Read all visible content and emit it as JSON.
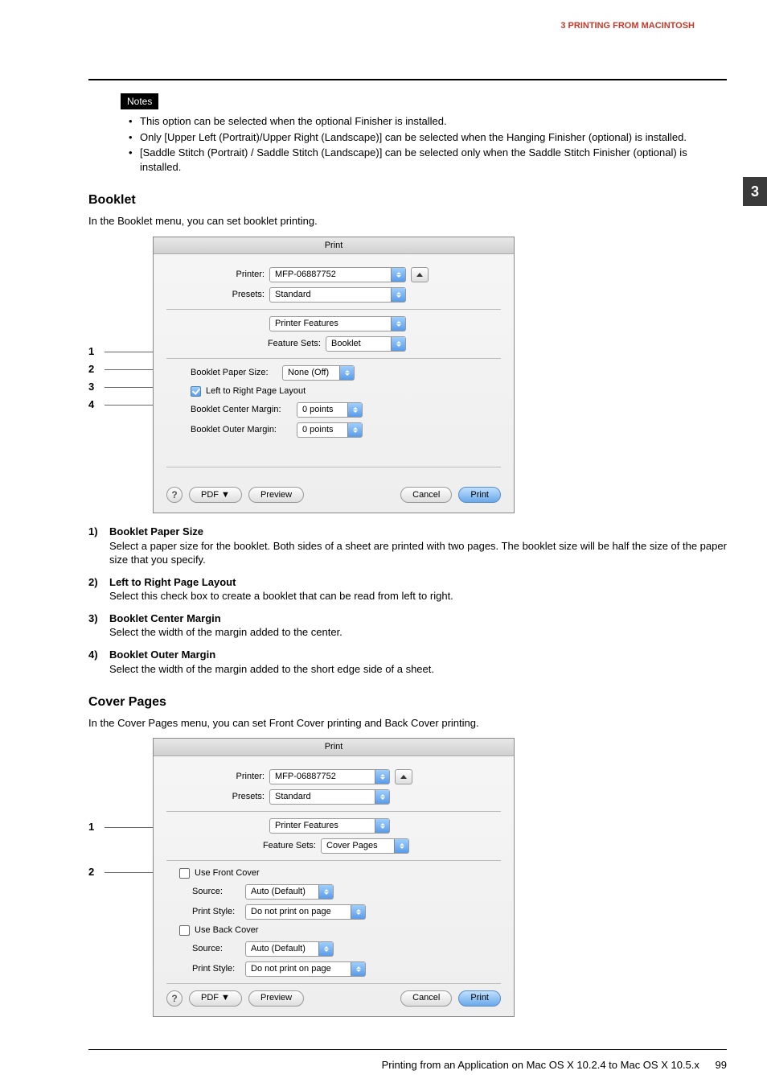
{
  "header": {
    "breadcrumb": "3 PRINTING FROM MACINTOSH",
    "tab": "3"
  },
  "notes": {
    "label": "Notes",
    "items": [
      "This option can be selected when the optional Finisher is installed.",
      "Only [Upper Left (Portrait)/Upper Right (Landscape)] can be selected when the Hanging Finisher (optional) is installed.",
      "[Saddle Stitch (Portrait) / Saddle Stitch (Landscape)] can be selected only when the Saddle Stitch Finisher (optional) is installed."
    ]
  },
  "booklet": {
    "heading": "Booklet",
    "intro": "In the Booklet menu, you can set booklet printing.",
    "callouts": [
      "1",
      "2",
      "3",
      "4"
    ],
    "dialog": {
      "title": "Print",
      "printer_label": "Printer:",
      "printer_value": "MFP-06887752",
      "presets_label": "Presets:",
      "presets_value": "Standard",
      "pane_value": "Printer Features",
      "featuresets_label": "Feature Sets:",
      "featuresets_value": "Booklet",
      "paper_label": "Booklet Paper Size:",
      "paper_value": "None (Off)",
      "ltr_label": "Left to Right Page Layout",
      "center_label": "Booklet Center Margin:",
      "center_value": "0 points",
      "outer_label": "Booklet Outer Margin:",
      "outer_value": "0 points",
      "help": "?",
      "pdf": "PDF ▼",
      "preview": "Preview",
      "cancel": "Cancel",
      "print": "Print"
    },
    "defs": [
      {
        "n": "1)",
        "t": "Booklet Paper Size",
        "d": "Select a paper size for the booklet. Both sides of a sheet are printed with two pages. The booklet size will be half the size of the paper size that you specify."
      },
      {
        "n": "2)",
        "t": "Left to Right Page Layout",
        "d": "Select this check box to create a booklet that can be read from left to right."
      },
      {
        "n": "3)",
        "t": "Booklet Center Margin",
        "d": "Select the width of the margin added to the center."
      },
      {
        "n": "4)",
        "t": "Booklet Outer Margin",
        "d": "Select the width of the margin added to the short edge side of a sheet."
      }
    ]
  },
  "cover": {
    "heading": "Cover Pages",
    "intro": "In the Cover Pages menu, you can set Front Cover printing and Back Cover printing.",
    "callouts": [
      "1",
      "2"
    ],
    "dialog": {
      "title": "Print",
      "printer_label": "Printer:",
      "printer_value": "MFP-06887752",
      "presets_label": "Presets:",
      "presets_value": "Standard",
      "pane_value": "Printer Features",
      "featuresets_label": "Feature Sets:",
      "featuresets_value": "Cover Pages",
      "front_label": "Use Front Cover",
      "source_label": "Source:",
      "source_value": "Auto (Default)",
      "style_label": "Print Style:",
      "style_value": "Do not print on page",
      "back_label": "Use Back Cover",
      "help": "?",
      "pdf": "PDF ▼",
      "preview": "Preview",
      "cancel": "Cancel",
      "print": "Print"
    }
  },
  "footer": {
    "text": "Printing from an Application on Mac OS X 10.2.4 to Mac OS X 10.5.x",
    "page": "99"
  }
}
